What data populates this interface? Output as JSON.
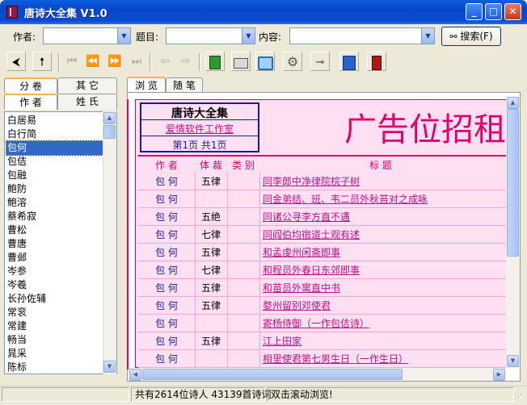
{
  "window": {
    "title": "唐诗大全集 V1.0",
    "min": "_",
    "max": "□",
    "close": "✕"
  },
  "search": {
    "author_label": "作者:",
    "title_label": "题目:",
    "content_label": "内容:",
    "author_value": "",
    "title_value": "",
    "content_value": "",
    "button_label": "搜索(F)"
  },
  "toolbar": {
    "back": "⮜",
    "up": "🠕",
    "first": "⏮",
    "prev": "⏪",
    "next": "⏩",
    "last": "⏭",
    "left": "⇦",
    "right": "⇨"
  },
  "left_tabs": [
    "分 卷",
    "其 它",
    "作 者",
    "姓 氏"
  ],
  "authors": [
    "白居易",
    "白行简",
    "包何",
    "包佶",
    "包融",
    "鲍防",
    "鲍溶",
    "蔡希寂",
    "曹松",
    "曹唐",
    "曹邺",
    "岑参",
    "岑羲",
    "长孙佐辅",
    "常衮",
    "常建",
    "畅当",
    "晁采",
    "陈标"
  ],
  "selected_author": "包何",
  "content_tabs": [
    "浏 览",
    "随 笔"
  ],
  "header": {
    "title": "唐诗大全集",
    "link": "爱情软件工作室",
    "page": "第1页 共1页"
  },
  "ad_text": "广告位招租",
  "table": {
    "columns": [
      "作 者",
      "体 裁",
      "类 别",
      "标 题"
    ],
    "rows": [
      {
        "author": "包 何",
        "form": "五律",
        "title": "同李郎中净律院梡子树"
      },
      {
        "author": "包 何",
        "form": "",
        "title": "同金弟结、班、韦二员外秋苔对之成咏"
      },
      {
        "author": "包 何",
        "form": "五绝",
        "title": "同诸公寻李方直不遇"
      },
      {
        "author": "包 何",
        "form": "七律",
        "title": "同阎伯均宿道士观有述"
      },
      {
        "author": "包 何",
        "form": "五律",
        "title": "和孟虔州闲斋即事"
      },
      {
        "author": "包 何",
        "form": "七律",
        "title": "和程员外春日东郊即事"
      },
      {
        "author": "包 何",
        "form": "五律",
        "title": "和苗员外寓直中书"
      },
      {
        "author": "包 何",
        "form": "五律",
        "title": "婺州留别邓使君"
      },
      {
        "author": "包 何",
        "form": "",
        "title": "寄杨侍御（一作包佶诗）"
      },
      {
        "author": "包 何",
        "form": "五律",
        "title": "江上田家"
      },
      {
        "author": "包 何",
        "form": "",
        "title": "相里使君第七男生日（一作生日）"
      }
    ]
  },
  "status": {
    "counts": "共有2614位诗人 43139首诗词",
    "hint": "双击滚动浏览!"
  },
  "colors": {
    "accent_pink": "#e0006a",
    "link": "#c0108a",
    "selection": "#316ac5"
  }
}
